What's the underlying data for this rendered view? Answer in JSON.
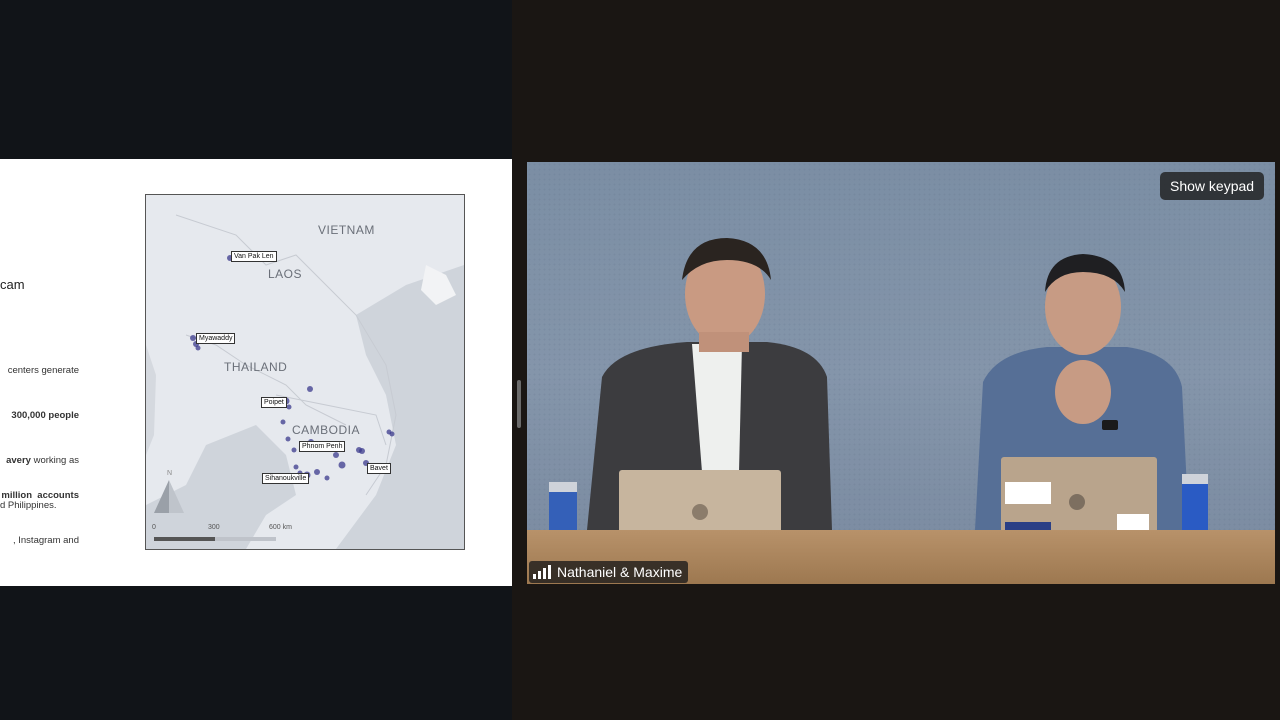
{
  "slide": {
    "heading": "cam",
    "paragraph1": [
      {
        "text": "centers generate"
      },
      {
        "text": " 300,000 people",
        "bold": true
      },
      {
        "bold_part": "avery",
        "rest": " working as"
      },
      {
        "text": "d Philippines."
      }
    ],
    "paragraph2": [
      {
        "text": "million  accounts",
        "bold": true
      },
      {
        "text": ", Instagram and"
      }
    ],
    "map": {
      "countries": [
        "VIETNAM",
        "LAOS",
        "THAILAND",
        "CAMBODIA"
      ],
      "cities": [
        "Van Pak Len",
        "Myawaddy",
        "Poipet",
        "Phnom Penh",
        "Bavet",
        "Sihanoukville"
      ],
      "scale": {
        "ticks": [
          "0",
          "300",
          "600 km"
        ]
      },
      "colors": {
        "water": "#cfd4db",
        "land": "#e6e9ee",
        "dot": "#3b3a8c"
      }
    }
  },
  "video": {
    "keypad_button": "Show keypad",
    "participant_name": "Nathaniel & Maxime"
  }
}
